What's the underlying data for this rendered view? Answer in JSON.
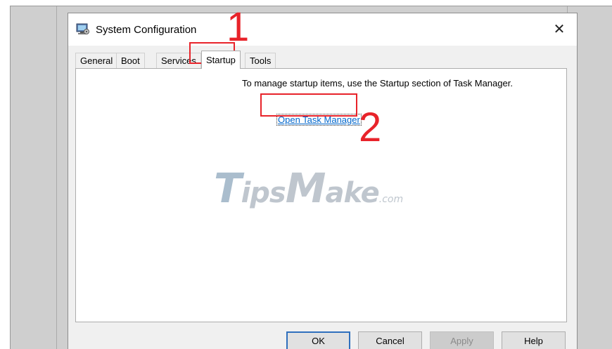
{
  "window": {
    "title": "System Configuration",
    "icon": "system-config-icon",
    "close_glyph": "✕"
  },
  "tabs": [
    {
      "label": "General",
      "active": false
    },
    {
      "label": "Boot",
      "active": false
    },
    {
      "label": "Services",
      "active": false
    },
    {
      "label": "Startup",
      "active": true
    },
    {
      "label": "Tools",
      "active": false
    }
  ],
  "panel": {
    "message": "To manage startup items, use the Startup section of Task Manager.",
    "link_label": "Open Task Manager"
  },
  "watermark": {
    "part1": "T",
    "part2": "ips",
    "part3": "M",
    "part4": "ake",
    "part5": ".com"
  },
  "buttons": {
    "ok": "OK",
    "cancel": "Cancel",
    "apply": "Apply",
    "help": "Help"
  },
  "annotations": {
    "step1": "1",
    "step2": "2",
    "color": "#e8232a"
  }
}
